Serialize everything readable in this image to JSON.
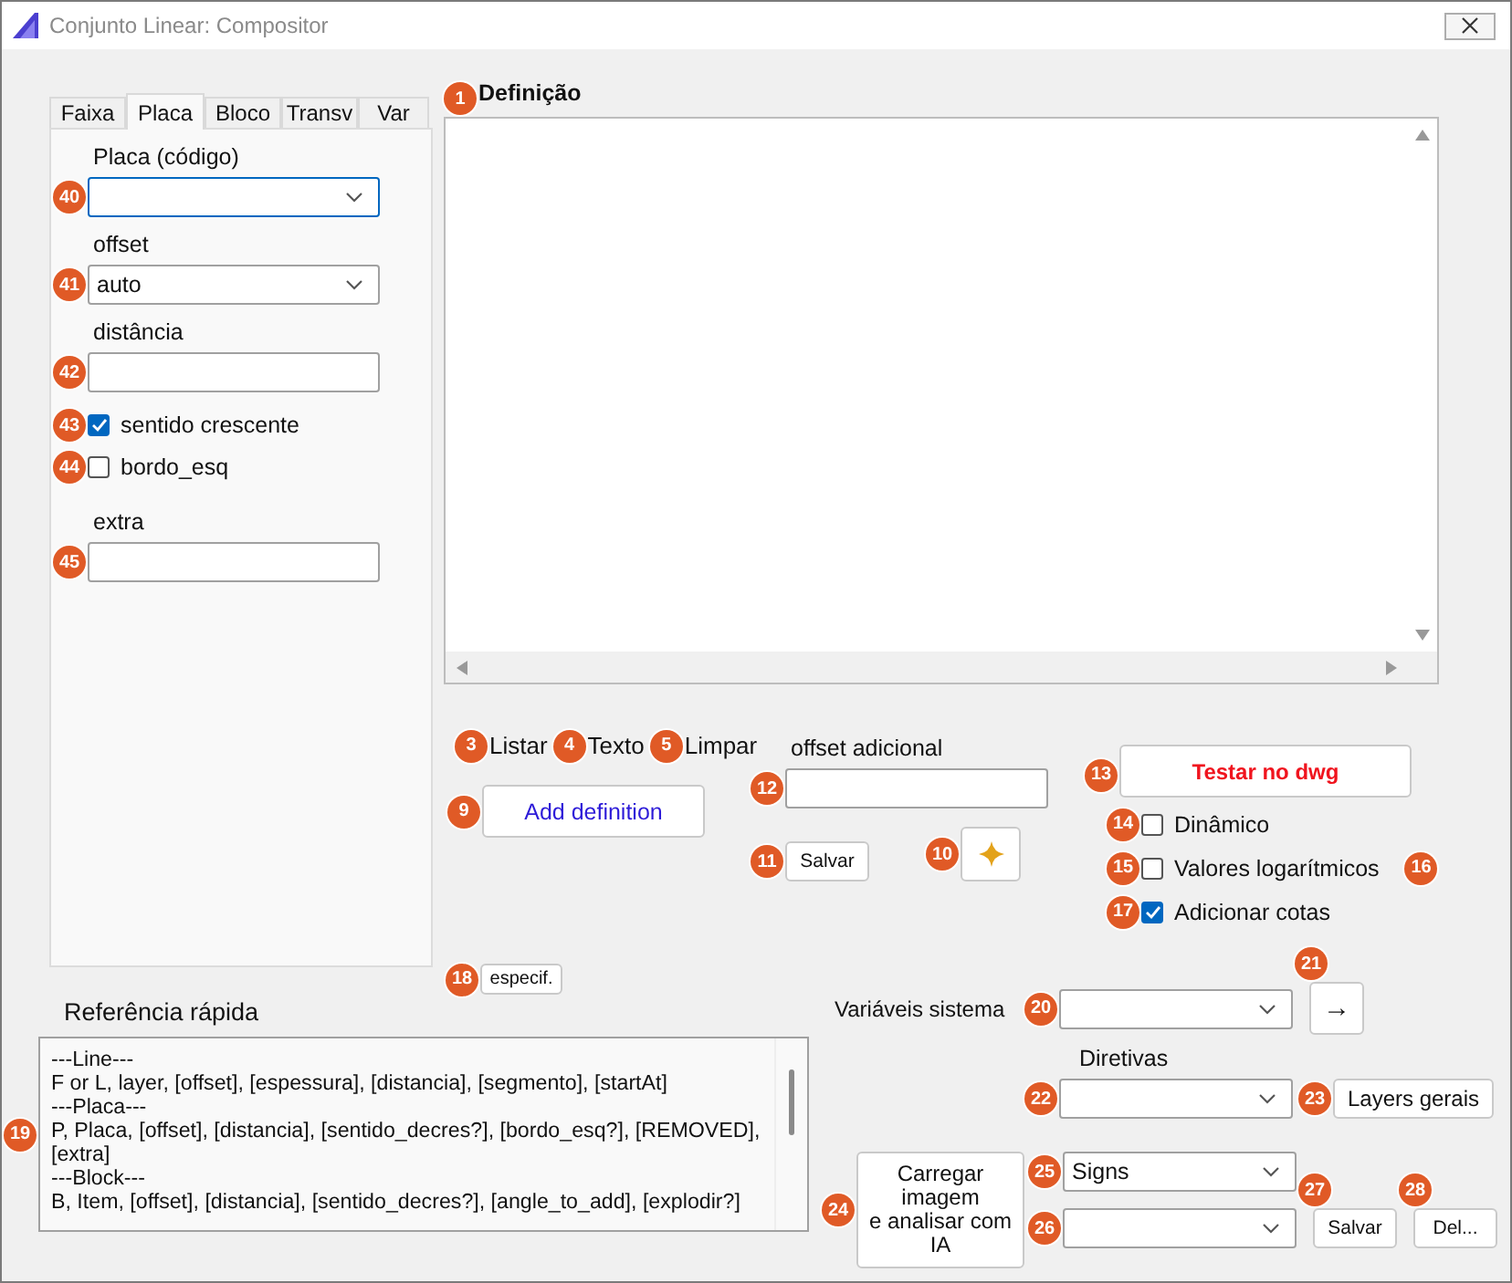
{
  "window": {
    "title": "Conjunto Linear: Compositor"
  },
  "tabs": [
    {
      "label": "Faixa",
      "selected": false
    },
    {
      "label": "Placa",
      "selected": true
    },
    {
      "label": "Bloco",
      "selected": false
    },
    {
      "label": "Transv",
      "selected": false
    },
    {
      "label": "Var",
      "selected": false
    }
  ],
  "placa_form": [
    {
      "kind": "combo",
      "label": "Placa (código)",
      "focused": true,
      "badge": "40"
    },
    {
      "kind": "combo",
      "label": "offset",
      "value": "auto",
      "focused": false,
      "badge": "41"
    },
    {
      "kind": "text",
      "label": "distância",
      "focused": false,
      "badge": "42"
    },
    {
      "kind": "check",
      "label": "sentido crescente",
      "checked": true,
      "badge": "43"
    },
    {
      "kind": "check",
      "label": "bordo_esq",
      "checked": false,
      "badge": "44"
    },
    {
      "kind": "text",
      "label": "extra",
      "focused": false,
      "badge": "45"
    }
  ],
  "definition": {
    "label": "Definição",
    "badge": "1"
  },
  "actions": [
    {
      "label": "Listar",
      "badge": "3"
    },
    {
      "label": "Texto",
      "badge": "4"
    },
    {
      "label": "Limpar",
      "badge": "5"
    }
  ],
  "add_button": {
    "label": "Add definition",
    "badge": "9"
  },
  "offset_adicional": {
    "label": "offset adicional",
    "badge": "12"
  },
  "save_button": {
    "label": "Salvar",
    "badge": "11"
  },
  "star_button": {
    "badge": "10"
  },
  "test_button": {
    "label": "Testar no dwg",
    "badge": "13"
  },
  "options": [
    {
      "label": "Dinâmico",
      "checked": false,
      "badge": "14"
    },
    {
      "label": "Valores logarítmicos",
      "checked": false,
      "badge": "15",
      "note_badge": "16"
    },
    {
      "label": "Adicionar cotas",
      "checked": true,
      "badge": "17"
    }
  ],
  "spec_button": {
    "label": "especif.",
    "badge": "18"
  },
  "quick_reference": {
    "title": "Referência rápida",
    "badge": "19",
    "lines": [
      "---Line---",
      "F or L, layer, [offset], [espessura], [distancia], [segmento], [startAt]",
      "---Placa---",
      "P, Placa, [offset], [distancia], [sentido_decres?], [bordo_esq?], [REMOVED], [extra]",
      "---Block---",
      "B, Item, [offset], [distancia], [sentido_decres?], [angle_to_add], [explodir?]"
    ]
  },
  "system_vars": {
    "label": "Variáveis sistema",
    "badge": "20"
  },
  "arrow_button": {
    "label": "→",
    "badge": "21"
  },
  "directives": {
    "label": "Diretivas",
    "badge": "22"
  },
  "layers_button": {
    "label": "Layers gerais",
    "badge": "23"
  },
  "image_button": {
    "label": "Carregar imagem\ne analisar com IA",
    "badge": "24"
  },
  "signs_combo": {
    "value": "Signs",
    "badge": "25"
  },
  "preset_combo": {
    "badge": "26"
  },
  "save2_button": {
    "label": "Salvar",
    "badge": "27"
  },
  "delete_button": {
    "label": "Del...",
    "badge": "28"
  }
}
